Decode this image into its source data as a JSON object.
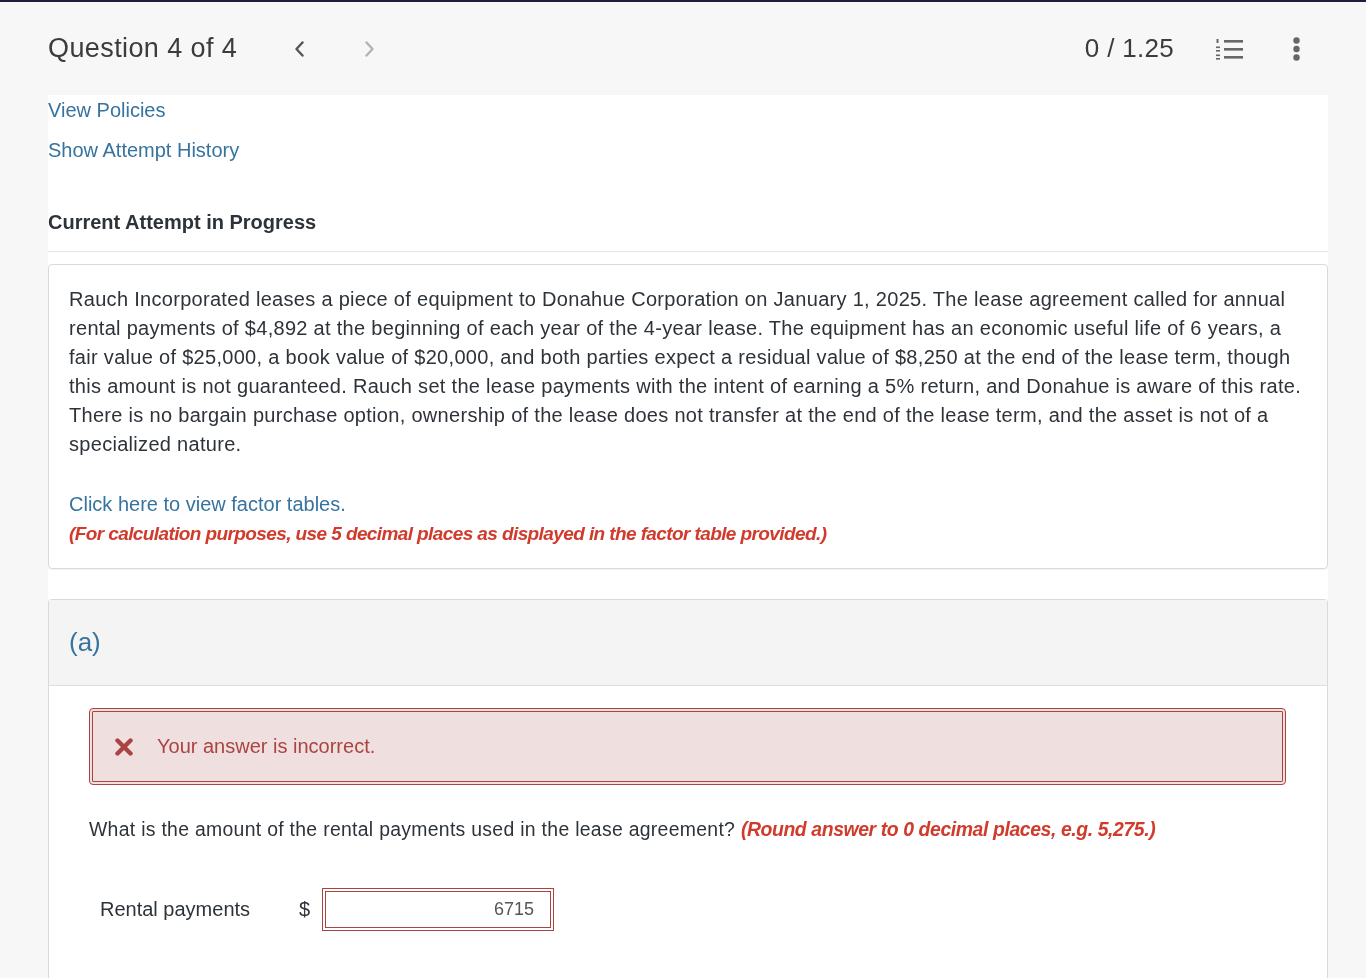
{
  "header": {
    "title": "Question 4 of 4",
    "navigation": [
      {
        "kind": "previous",
        "disabled": false
      },
      {
        "kind": "next",
        "disabled": true
      }
    ],
    "score": "0 / 1.25"
  },
  "links": [
    "View Policies",
    "Show Attempt History"
  ],
  "attempt_heading": "Current Attempt in Progress",
  "question": {
    "paragraph": "Rauch Incorporated leases a piece of equipment to Donahue Corporation on January 1, 2025. The lease agreement called for annual rental payments of $4,892 at the beginning of each year of the 4-year lease. The equipment has an economic useful life of 6 years, a fair value of $25,000, a book value of $20,000, and both parties expect a residual value of $8,250 at the end of the lease term, though this amount is not guaranteed. Rauch set the lease payments with the intent of earning a 5% return, and Donahue is aware of this rate. There is no bargain purchase option, ownership of the lease does not transfer at the end of the lease term, and the asset is not of a specialized nature.",
    "factor_link": "Click here to view factor tables.",
    "note": "(For calculation purposes, use 5 decimal places as displayed in the factor table provided.)"
  },
  "parts": [
    {
      "label": "(a)",
      "feedback": {
        "kind": "incorrect",
        "text": "Your answer is incorrect."
      },
      "prompt": "What is the amount of the rental payments used in the lease agreement? **(Round answer to 0 decimal places, e.g. 5,275.)**",
      "answers": [
        {
          "label": "Rental payments",
          "prefix": "$",
          "value": "6715",
          "incorrect": true
        }
      ]
    }
  ]
}
